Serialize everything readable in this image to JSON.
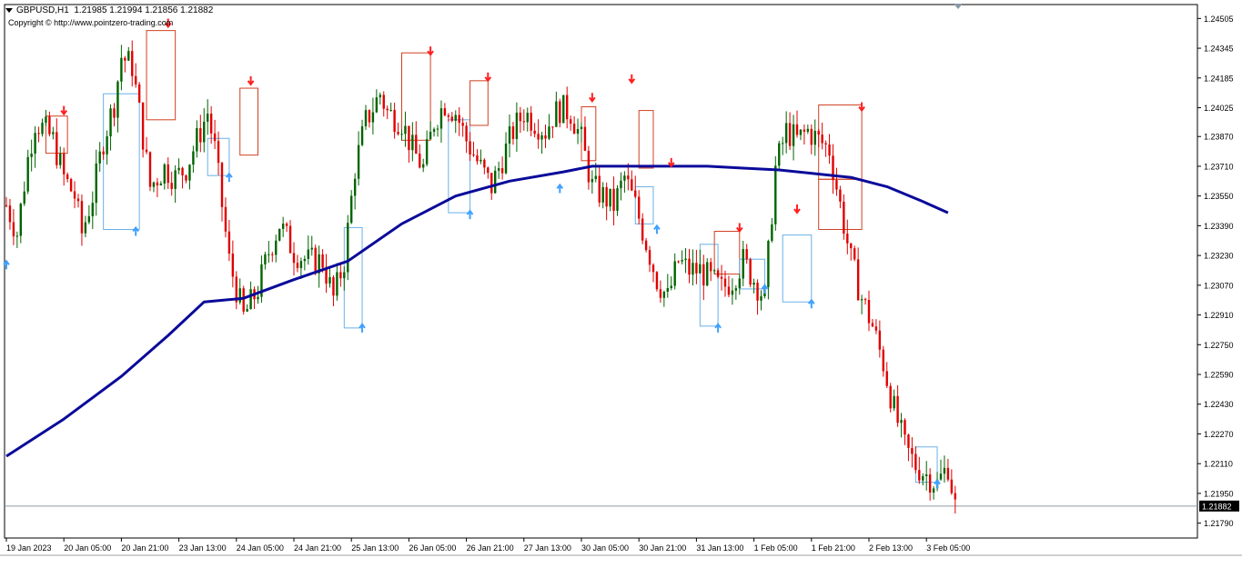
{
  "header": {
    "symbol": "GBPUSD,H1",
    "ohlc": "1.21985 1.21994 1.21856 1.21882",
    "copyright": "Copyright © http://www.pointzero-trading.com"
  },
  "colors": {
    "bull": "#006400",
    "bear": "#e00000",
    "ma": "#0a0a9a",
    "up_arrow": "#3fa0ff",
    "down_arrow": "#ff2020",
    "demand_box": "#6ab0e8",
    "supply_box": "#d04020",
    "grid": "#000000",
    "price_line": "#8a9aa6"
  },
  "chart_data": {
    "type": "candlestick",
    "ylim": [
      1.2171,
      1.2458
    ],
    "y_ticks": [
      "1.24505",
      "1.24345",
      "1.24185",
      "1.24025",
      "1.23870",
      "1.23710",
      "1.23550",
      "1.23390",
      "1.23230",
      "1.23070",
      "1.22910",
      "1.22750",
      "1.22590",
      "1.22430",
      "1.22270",
      "1.22110",
      "1.21950",
      "1.21790"
    ],
    "x_ticks": [
      "19 Jan 2023",
      "20 Jan 05:00",
      "20 Jan 21:00",
      "23 Jan 13:00",
      "24 Jan 05:00",
      "24 Jan 21:00",
      "25 Jan 13:00",
      "26 Jan 05:00",
      "26 Jan 21:00",
      "27 Jan 13:00",
      "30 Jan 05:00",
      "30 Jan 21:00",
      "31 Jan 13:00",
      "1 Feb 05:00",
      "1 Feb 21:00",
      "2 Feb 13:00",
      "3 Feb 05:00"
    ],
    "current_price": "1.21882",
    "close_path": [
      [
        0,
        1.235
      ],
      [
        3,
        1.2335
      ],
      [
        6,
        1.2375
      ],
      [
        8,
        1.2395
      ],
      [
        11,
        1.239
      ],
      [
        13,
        1.2385
      ],
      [
        16,
        1.2365
      ],
      [
        19,
        1.2355
      ],
      [
        21,
        1.2335
      ],
      [
        24,
        1.2355
      ],
      [
        27,
        1.2385
      ],
      [
        30,
        1.2405
      ],
      [
        32,
        1.243
      ],
      [
        35,
        1.2425
      ],
      [
        37,
        1.24
      ],
      [
        40,
        1.236
      ],
      [
        44,
        1.237
      ],
      [
        47,
        1.2365
      ],
      [
        50,
        1.237
      ],
      [
        53,
        1.2385
      ],
      [
        56,
        1.24
      ],
      [
        58,
        1.238
      ],
      [
        62,
        1.232
      ],
      [
        66,
        1.229
      ],
      [
        70,
        1.2305
      ],
      [
        73,
        1.2325
      ],
      [
        76,
        1.234
      ],
      [
        80,
        1.2325
      ],
      [
        84,
        1.232
      ],
      [
        88,
        1.232
      ],
      [
        91,
        1.23
      ],
      [
        94,
        1.232
      ],
      [
        97,
        1.237
      ],
      [
        100,
        1.2395
      ],
      [
        104,
        1.241
      ],
      [
        106,
        1.24
      ],
      [
        110,
        1.2395
      ],
      [
        113,
        1.238
      ],
      [
        116,
        1.237
      ],
      [
        119,
        1.2395
      ],
      [
        122,
        1.2405
      ],
      [
        125,
        1.24
      ],
      [
        128,
        1.2385
      ],
      [
        132,
        1.237
      ],
      [
        135,
        1.236
      ],
      [
        138,
        1.2375
      ],
      [
        141,
        1.239
      ],
      [
        144,
        1.24
      ],
      [
        147,
        1.2395
      ],
      [
        150,
        1.239
      ],
      [
        152,
        1.2398
      ],
      [
        154,
        1.2402
      ],
      [
        157,
        1.24
      ],
      [
        160,
        1.2385
      ],
      [
        163,
        1.236
      ],
      [
        166,
        1.2355
      ],
      [
        169,
        1.235
      ],
      [
        172,
        1.2365
      ],
      [
        175,
        1.235
      ],
      [
        178,
        1.233
      ],
      [
        181,
        1.231
      ],
      [
        184,
        1.23
      ],
      [
        187,
        1.232
      ],
      [
        190,
        1.2315
      ],
      [
        193,
        1.2315
      ],
      [
        196,
        1.231
      ],
      [
        199,
        1.2305
      ],
      [
        202,
        1.231
      ],
      [
        205,
        1.232
      ],
      [
        208,
        1.231
      ],
      [
        211,
        1.23
      ],
      [
        214,
        1.237
      ],
      [
        217,
        1.239
      ],
      [
        220,
        1.2385
      ],
      [
        223,
        1.239
      ],
      [
        226,
        1.2385
      ],
      [
        229,
        1.238
      ],
      [
        232,
        1.235
      ],
      [
        235,
        1.232
      ],
      [
        238,
        1.23
      ],
      [
        241,
        1.2285
      ],
      [
        244,
        1.2265
      ],
      [
        247,
        1.224
      ],
      [
        250,
        1.222
      ],
      [
        253,
        1.221
      ],
      [
        256,
        1.2205
      ],
      [
        259,
        1.22
      ],
      [
        262,
        1.221
      ],
      [
        264,
        1.2188
      ]
    ],
    "ma_path": [
      [
        0,
        1.2215
      ],
      [
        16,
        1.2235
      ],
      [
        32,
        1.2258
      ],
      [
        45,
        1.228
      ],
      [
        55,
        1.2298
      ],
      [
        66,
        1.23
      ],
      [
        80,
        1.231
      ],
      [
        95,
        1.232
      ],
      [
        110,
        1.234
      ],
      [
        125,
        1.2355
      ],
      [
        140,
        1.2363
      ],
      [
        155,
        1.2368
      ],
      [
        163,
        1.2371
      ],
      [
        170,
        1.2371
      ],
      [
        185,
        1.2371
      ],
      [
        195,
        1.2371
      ],
      [
        205,
        1.237
      ],
      [
        215,
        1.2369
      ],
      [
        225,
        1.2367
      ],
      [
        235,
        1.2365
      ],
      [
        245,
        1.236
      ],
      [
        255,
        1.2352
      ],
      [
        262,
        1.2346
      ]
    ],
    "markers": [
      {
        "type": "down",
        "bar": 16,
        "price": 1.24
      },
      {
        "type": "down",
        "bar": 45,
        "price": 1.2447
      },
      {
        "type": "down",
        "bar": 68,
        "price": 1.2416
      },
      {
        "type": "down",
        "bar": 118,
        "price": 1.2432
      },
      {
        "type": "down",
        "bar": 134,
        "price": 1.2418
      },
      {
        "type": "down",
        "bar": 163,
        "price": 1.2407
      },
      {
        "type": "down",
        "bar": 174,
        "price": 1.2417
      },
      {
        "type": "down",
        "bar": 185,
        "price": 1.2372
      },
      {
        "type": "down",
        "bar": 204,
        "price": 1.2337
      },
      {
        "type": "down",
        "bar": 220,
        "price": 1.2347
      },
      {
        "type": "down",
        "bar": 238,
        "price": 1.2402
      },
      {
        "type": "up",
        "bar": 0,
        "price": 1.2319
      },
      {
        "type": "up",
        "bar": 36,
        "price": 1.2337
      },
      {
        "type": "up",
        "bar": 62,
        "price": 1.2366
      },
      {
        "type": "up",
        "bar": 99,
        "price": 1.2285
      },
      {
        "type": "up",
        "bar": 129,
        "price": 1.2346
      },
      {
        "type": "up",
        "bar": 154,
        "price": 1.236
      },
      {
        "type": "up",
        "bar": 181,
        "price": 1.2338
      },
      {
        "type": "up",
        "bar": 198,
        "price": 1.2285
      },
      {
        "type": "up",
        "bar": 211,
        "price": 1.2306
      },
      {
        "type": "up",
        "bar": 224,
        "price": 1.2298
      },
      {
        "type": "up",
        "bar": 259,
        "price": 1.2201
      }
    ],
    "zones": [
      {
        "type": "supply",
        "b0": 11,
        "b1": 17,
        "p0": 1.2378,
        "p1": 1.2398
      },
      {
        "type": "demand",
        "b0": 27,
        "b1": 37,
        "p0": 1.2337,
        "p1": 1.241
      },
      {
        "type": "supply",
        "b0": 39,
        "b1": 47,
        "p0": 1.2396,
        "p1": 1.2444
      },
      {
        "type": "demand",
        "b0": 56,
        "b1": 62,
        "p0": 1.2366,
        "p1": 1.2386
      },
      {
        "type": "supply",
        "b0": 65,
        "b1": 70,
        "p0": 1.2377,
        "p1": 1.2413
      },
      {
        "type": "demand",
        "b0": 94,
        "b1": 99,
        "p0": 1.2284,
        "p1": 1.2338
      },
      {
        "type": "supply",
        "b0": 110,
        "b1": 118,
        "p0": 1.2385,
        "p1": 1.2432
      },
      {
        "type": "demand",
        "b0": 123,
        "b1": 129,
        "p0": 1.2346,
        "p1": 1.2396
      },
      {
        "type": "supply",
        "b0": 129,
        "b1": 134,
        "p0": 1.2393,
        "p1": 1.2417
      },
      {
        "type": "supply",
        "b0": 160,
        "b1": 164,
        "p0": 1.2374,
        "p1": 1.2403
      },
      {
        "type": "demand",
        "b0": 175,
        "b1": 180,
        "p0": 1.234,
        "p1": 1.236
      },
      {
        "type": "supply",
        "b0": 176,
        "b1": 180,
        "p0": 1.237,
        "p1": 1.2401
      },
      {
        "type": "demand",
        "b0": 193,
        "b1": 198,
        "p0": 1.2285,
        "p1": 1.2329
      },
      {
        "type": "supply",
        "b0": 197,
        "b1": 204,
        "p0": 1.2313,
        "p1": 1.2336
      },
      {
        "type": "demand",
        "b0": 204,
        "b1": 211,
        "p0": 1.2305,
        "p1": 1.2321
      },
      {
        "type": "demand",
        "b0": 216,
        "b1": 224,
        "p0": 1.2298,
        "p1": 1.2334
      },
      {
        "type": "supply",
        "b0": 226,
        "b1": 238,
        "p0": 1.2364,
        "p1": 1.2404
      },
      {
        "type": "supply",
        "b0": 226,
        "b1": 238,
        "p0": 1.2337,
        "p1": 1.2364
      },
      {
        "type": "demand",
        "b0": 253,
        "b1": 259,
        "p0": 1.2201,
        "p1": 1.222
      }
    ]
  }
}
